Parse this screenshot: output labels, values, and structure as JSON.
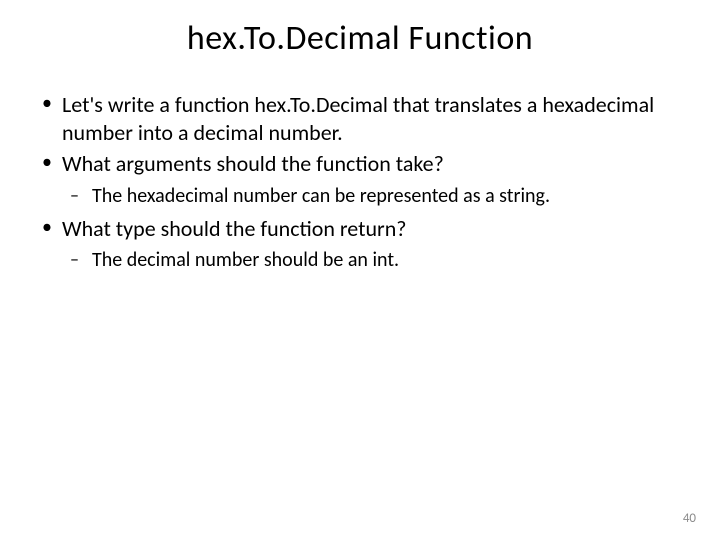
{
  "title": "hex.To.Decimal Function",
  "bullets": {
    "b0": "Let's write a function hex.To.Decimal that translates a hexadecimal number into a decimal number.",
    "b1": "What arguments should the function take?",
    "b1_sub0": "The hexadecimal number can be represented as a string.",
    "b2": "What type should the function return?",
    "b2_sub0": "The decimal number should be an int."
  },
  "page_number": "40"
}
